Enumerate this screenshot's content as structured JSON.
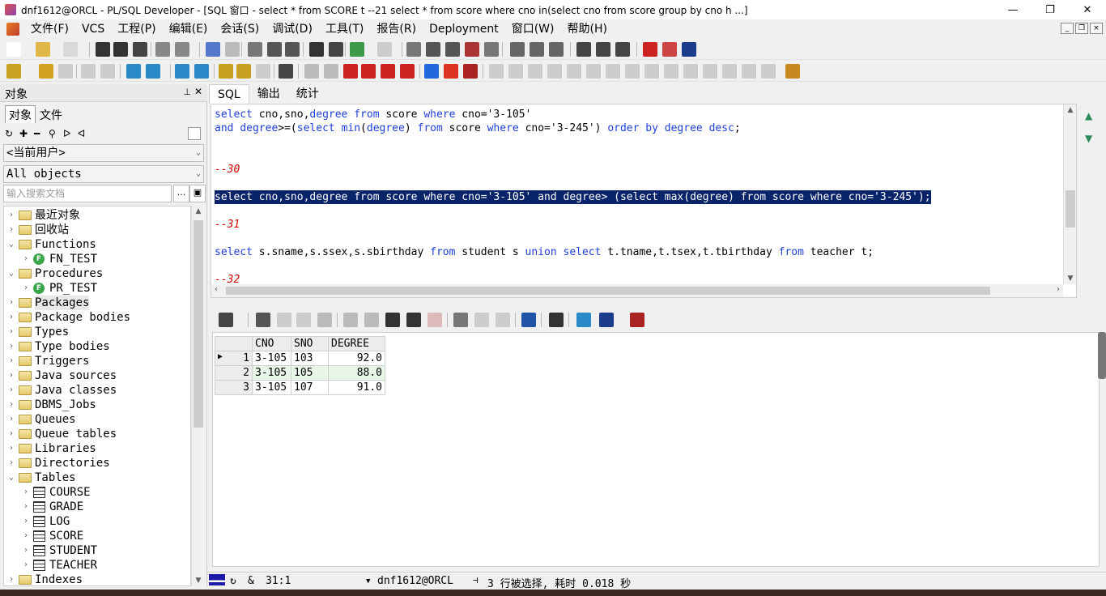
{
  "window": {
    "title": "dnf1612@ORCL - PL/SQL Developer - [SQL 窗口 - select * from SCORE t --21 select * from score where cno in(select cno from score group by cno h ...]",
    "controls": [
      "—",
      "❐",
      "✕"
    ]
  },
  "menu": {
    "items": [
      "文件(F)",
      "VCS",
      "工程(P)",
      "编辑(E)",
      "会话(S)",
      "调试(D)",
      "工具(T)",
      "报告(R)",
      "Deployment",
      "窗口(W)",
      "帮助(H)"
    ],
    "mdi_controls": [
      "_",
      "❐",
      "×"
    ]
  },
  "left_panel": {
    "header": "对象",
    "pin": "⊥",
    "close": "✕",
    "tabs": [
      "对象",
      "文件"
    ],
    "user_combo": "<当前用户>",
    "filter_combo": "All objects",
    "search_placeholder": "输入搜索文档",
    "search_btn": "...",
    "tree": [
      {
        "label": "最近对象",
        "type": "folder",
        "level": 0,
        "exp": "›"
      },
      {
        "label": "回收站",
        "type": "folder",
        "level": 0,
        "exp": "›"
      },
      {
        "label": "Functions",
        "type": "folder",
        "level": 0,
        "exp": "⌄"
      },
      {
        "label": "FN_TEST",
        "type": "func",
        "level": 1,
        "exp": "›"
      },
      {
        "label": "Procedures",
        "type": "folder",
        "level": 0,
        "exp": "⌄"
      },
      {
        "label": "PR_TEST",
        "type": "func",
        "level": 1,
        "exp": "›"
      },
      {
        "label": "Packages",
        "type": "folder",
        "level": 0,
        "exp": "›",
        "selected": true
      },
      {
        "label": "Package bodies",
        "type": "folder",
        "level": 0,
        "exp": "›"
      },
      {
        "label": "Types",
        "type": "folder",
        "level": 0,
        "exp": "›"
      },
      {
        "label": "Type bodies",
        "type": "folder",
        "level": 0,
        "exp": "›"
      },
      {
        "label": "Triggers",
        "type": "folder",
        "level": 0,
        "exp": "›"
      },
      {
        "label": "Java sources",
        "type": "folder",
        "level": 0,
        "exp": "›"
      },
      {
        "label": "Java classes",
        "type": "folder",
        "level": 0,
        "exp": "›"
      },
      {
        "label": "DBMS_Jobs",
        "type": "folder",
        "level": 0,
        "exp": "›"
      },
      {
        "label": "Queues",
        "type": "folder",
        "level": 0,
        "exp": "›"
      },
      {
        "label": "Queue tables",
        "type": "folder",
        "level": 0,
        "exp": "›"
      },
      {
        "label": "Libraries",
        "type": "folder",
        "level": 0,
        "exp": "›"
      },
      {
        "label": "Directories",
        "type": "folder",
        "level": 0,
        "exp": "›"
      },
      {
        "label": "Tables",
        "type": "folder",
        "level": 0,
        "exp": "⌄"
      },
      {
        "label": "COURSE",
        "type": "table",
        "level": 1,
        "exp": "›"
      },
      {
        "label": "GRADE",
        "type": "table",
        "level": 1,
        "exp": "›"
      },
      {
        "label": "LOG",
        "type": "table",
        "level": 1,
        "exp": "›"
      },
      {
        "label": "SCORE",
        "type": "table",
        "level": 1,
        "exp": "›"
      },
      {
        "label": "STUDENT",
        "type": "table",
        "level": 1,
        "exp": "›"
      },
      {
        "label": "TEACHER",
        "type": "table",
        "level": 1,
        "exp": "›"
      },
      {
        "label": "Indexes",
        "type": "folder",
        "level": 0,
        "exp": "›"
      }
    ]
  },
  "editor": {
    "tabs": [
      "SQL",
      "输出",
      "统计"
    ],
    "lines": [
      {
        "parts": [
          [
            "kw",
            "select"
          ],
          [
            "str",
            " cno,sno,"
          ],
          [
            "kw",
            "degree"
          ],
          [
            "str",
            " "
          ],
          [
            "kw",
            "from"
          ],
          [
            "str",
            " score "
          ],
          [
            "kw",
            "where"
          ],
          [
            "str",
            " cno='3-105'"
          ]
        ]
      },
      {
        "parts": [
          [
            "kw",
            "and"
          ],
          [
            "str",
            " "
          ],
          [
            "kw",
            "degree"
          ],
          [
            "str",
            ">=("
          ],
          [
            "kw",
            "select"
          ],
          [
            "str",
            " "
          ],
          [
            "kw",
            "min"
          ],
          [
            "str",
            "("
          ],
          [
            "kw",
            "degree"
          ],
          [
            "str",
            ") "
          ],
          [
            "kw",
            "from"
          ],
          [
            "str",
            " score "
          ],
          [
            "kw",
            "where"
          ],
          [
            "str",
            " cno='3-245') "
          ],
          [
            "kw",
            "order by"
          ],
          [
            "str",
            " "
          ],
          [
            "kw",
            "degree"
          ],
          [
            "str",
            " "
          ],
          [
            "kw",
            "desc"
          ],
          [
            "str",
            ";"
          ]
        ]
      },
      {
        "parts": []
      },
      {
        "parts": []
      },
      {
        "parts": [
          [
            "cm",
            "--30"
          ]
        ]
      },
      {
        "parts": []
      },
      {
        "parts": [
          [
            "kw",
            "select"
          ],
          [
            "str",
            " cno,sno,"
          ],
          [
            "kw",
            "degree"
          ],
          [
            "str",
            " "
          ],
          [
            "kw",
            "from"
          ],
          [
            "str",
            " score "
          ],
          [
            "kw",
            "where"
          ],
          [
            "str",
            " cno='3-105' "
          ],
          [
            "kw",
            "and"
          ],
          [
            "str",
            " "
          ],
          [
            "kw",
            "degree"
          ],
          [
            "str",
            "> ("
          ],
          [
            "kw",
            "select"
          ],
          [
            "str",
            " "
          ],
          [
            "kw",
            "max"
          ],
          [
            "str",
            "("
          ],
          [
            "kw",
            "degree"
          ],
          [
            "str",
            ") "
          ],
          [
            "kw",
            "from"
          ],
          [
            "str",
            " score "
          ],
          [
            "kw",
            "where"
          ],
          [
            "str",
            " cno='3-245');"
          ]
        ],
        "highlight": true
      },
      {
        "parts": []
      },
      {
        "parts": [
          [
            "cm",
            "--31"
          ]
        ]
      },
      {
        "parts": []
      },
      {
        "parts": [
          [
            "kw",
            "select"
          ],
          [
            "str",
            " s.sname,s.ssex,s.sbirthday "
          ],
          [
            "kw",
            "from"
          ],
          [
            "str",
            " student s "
          ],
          [
            "kw",
            "union"
          ],
          [
            "str",
            " "
          ],
          [
            "kw",
            "select"
          ],
          [
            "str",
            " t.tname,t.tsex,t.tbirthday "
          ],
          [
            "kw",
            "from"
          ],
          [
            "str",
            " teacher t;"
          ]
        ]
      },
      {
        "parts": []
      },
      {
        "parts": [
          [
            "cm",
            "--32"
          ]
        ]
      }
    ]
  },
  "grid": {
    "columns": [
      "CNO",
      "SNO",
      "DEGREE"
    ],
    "rows": [
      {
        "n": "1",
        "cno": "3-105",
        "sno": "103",
        "degree": "92.0",
        "current": true
      },
      {
        "n": "2",
        "cno": "3-105",
        "sno": "105",
        "degree": "88.0"
      },
      {
        "n": "3",
        "cno": "3-105",
        "sno": "107",
        "degree": "91.0"
      }
    ]
  },
  "status": {
    "position": "31:1",
    "connection": "dnf1612@ORCL",
    "message": "3 行被选择, 耗时 0.018 秒",
    "ampersand": "&"
  }
}
